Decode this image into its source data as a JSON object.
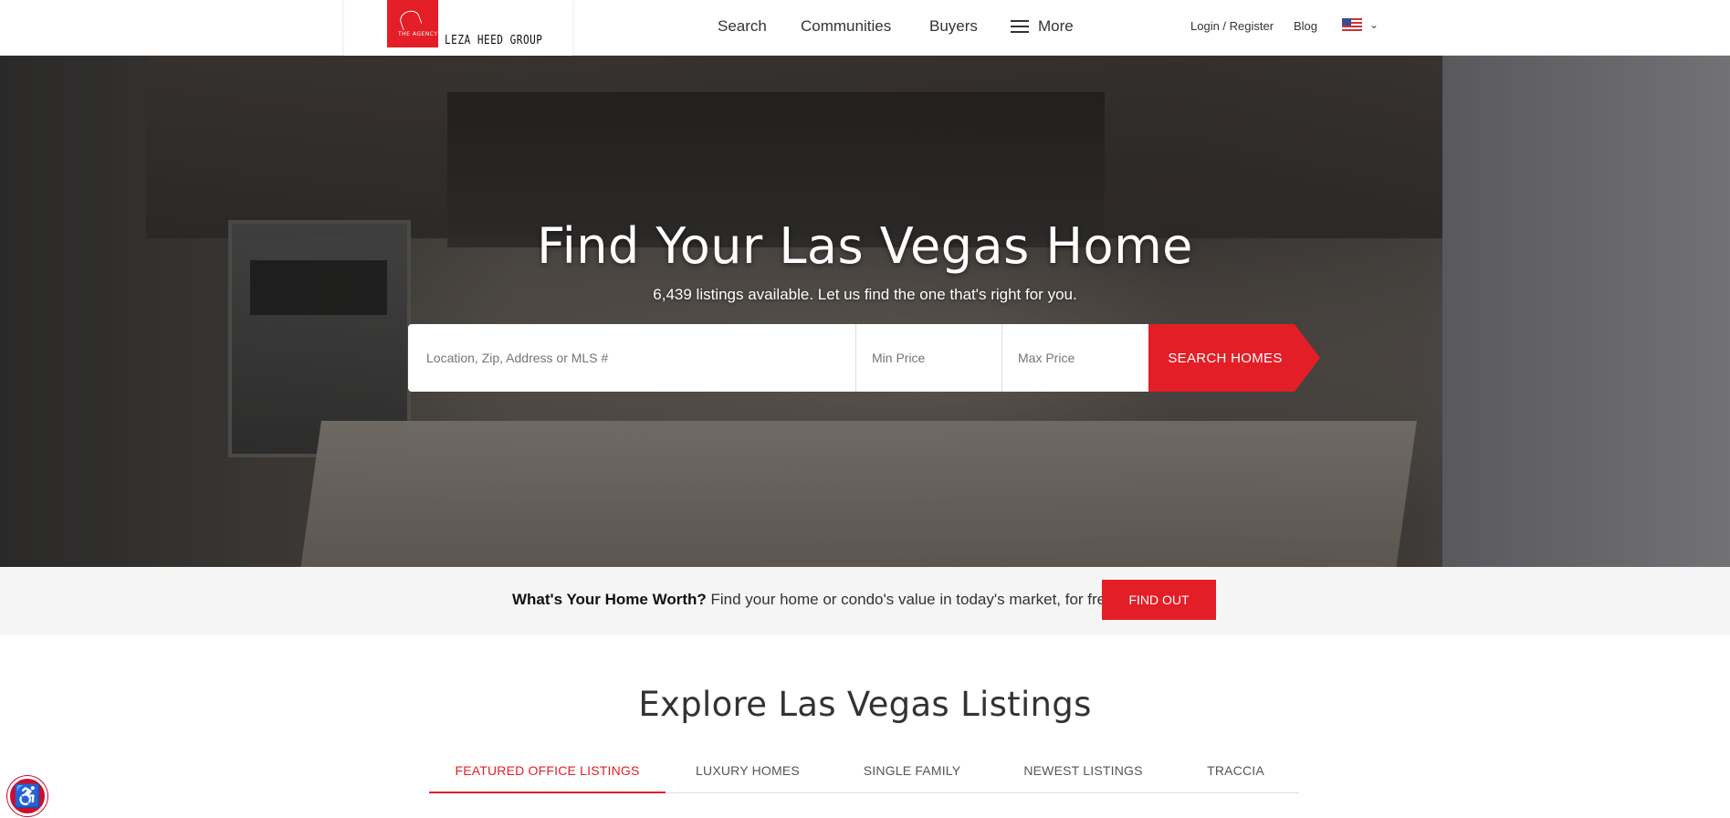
{
  "header": {
    "logo_small": "THE AGENCY",
    "logo_text": "LEZA HEED GROUP",
    "nav": [
      "Search",
      "Communities",
      "Buyers"
    ],
    "more_label": "More",
    "login_label": "Login / Register",
    "blog_label": "Blog",
    "language_icon": "us-flag-icon"
  },
  "hero": {
    "title": "Find Your Las Vegas Home",
    "subtitle": "6,439 listings available. Let us find the one that's right for you.",
    "location_placeholder": "Location, Zip, Address or MLS #",
    "min_price_placeholder": "Min Price",
    "max_price_placeholder": "Max Price",
    "search_button": "SEARCH HOMES"
  },
  "home_worth": {
    "bold": "What's Your Home Worth?",
    "text": "Find your home or condo's value in today's market, for free.",
    "button": "FIND OUT"
  },
  "explore": {
    "title": "Explore Las Vegas Listings",
    "tabs": [
      "FEATURED OFFICE LISTINGS",
      "LUXURY HOMES",
      "SINGLE FAMILY",
      "NEWEST LISTINGS",
      "TRACCIA"
    ],
    "active_tab": 0
  },
  "colors": {
    "accent": "#e41e26"
  }
}
